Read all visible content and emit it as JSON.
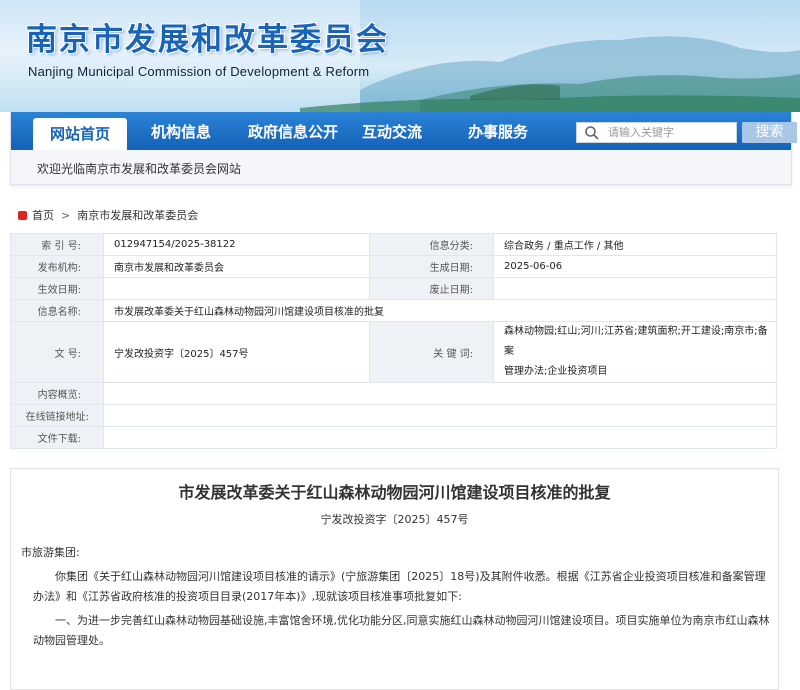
{
  "header": {
    "title_cn": "南京市发展和改革委员会",
    "title_en": "Nanjing Municipal Commission of Development & Reform"
  },
  "nav": {
    "items": [
      "网站首页",
      "机构信息",
      "政府信息公开",
      "互动交流",
      "办事服务"
    ],
    "search_placeholder": "请输入关键字",
    "search_button": "搜索",
    "welcome": "欢迎光临南京市发展和改革委员会网站"
  },
  "breadcrumb": {
    "home": "首页",
    "sep": ">",
    "current": "南京市发展和改革委员会"
  },
  "info": {
    "index_label": "索 引 号:",
    "index_value": "012947154/2025-38122",
    "category_label": "信息分类:",
    "category_value": "综合政务 / 重点工作 / 其他",
    "org_label": "发布机构:",
    "org_value": "南京市发展和改革委员会",
    "gen_date_label": "生成日期:",
    "gen_date_value": "2025-06-06",
    "eff_date_label": "生效日期:",
    "abolish_label": "废止日期:",
    "name_label": "信息名称:",
    "name_value": "市发展改革委关于红山森林动物园河川馆建设项目核准的批复",
    "doc_label": "文    号:",
    "doc_value": "宁发改投资字〔2025〕457号",
    "keywords_label": "关 键 词:",
    "keywords_line1": "森林动物园;红山;河川;江苏省;建筑面积;开工建设;南京市;备案",
    "keywords_line2": "管理办法;企业投资项目",
    "summary_label": "内容概览:",
    "url_label": "在线链接地址:",
    "download_label": "文件下载:"
  },
  "article": {
    "title": "市发展改革委关于红山森林动物园河川馆建设项目核准的批复",
    "doc_no": "宁发改投资字〔2025〕457号",
    "addressee": "市旅游集团:",
    "para1": "你集团《关于红山森林动物园河川馆建设项目核准的请示》(宁旅游集团〔2025〕18号)及其附件收悉。根据《江苏省企业投资项目核准和备案管理办法》和《江苏省政府核准的投资项目目录(2017年本)》,现就该项目核准事项批复如下:",
    "para2": "一、为进一步完善红山森林动物园基础设施,丰富馆舍环境,优化功能分区,同意实施红山森林动物园河川馆建设项目。项目实施单位为南京市红山森林动物园管理处。"
  }
}
